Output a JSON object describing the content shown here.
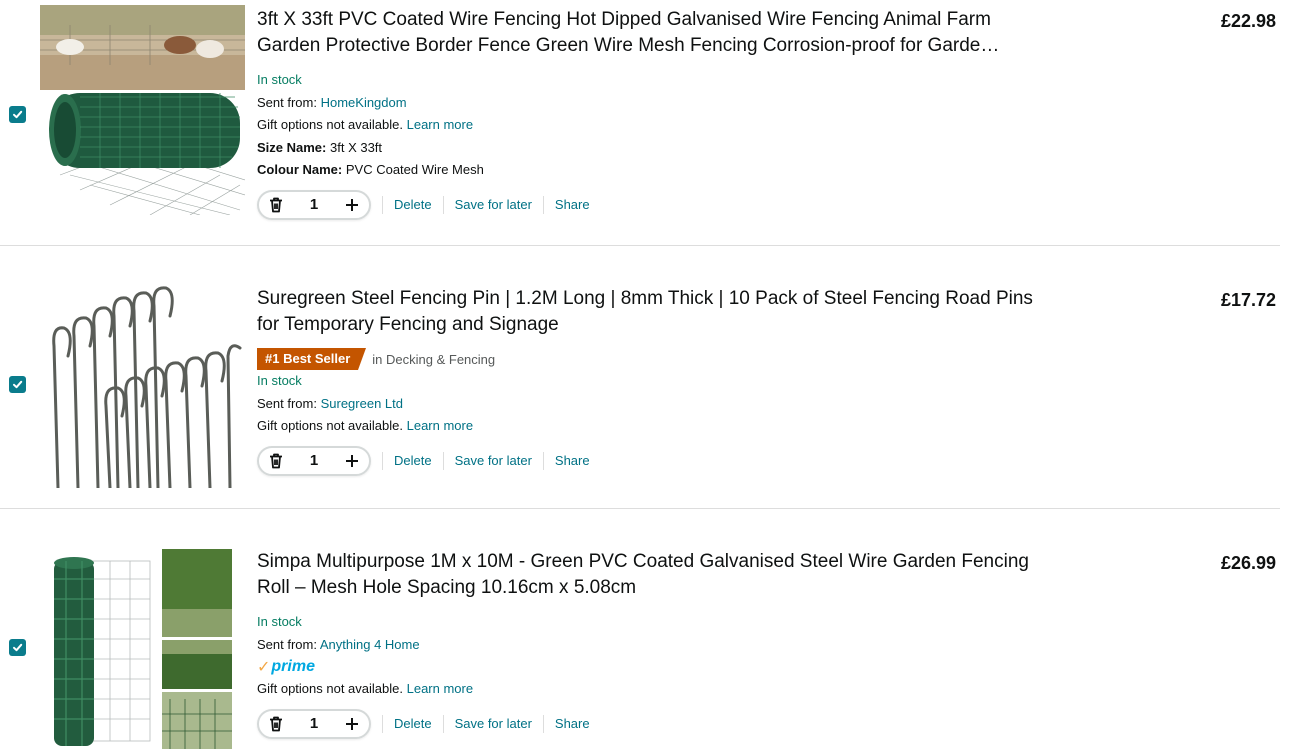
{
  "cart": {
    "items": [
      {
        "title": "3ft X 33ft PVC Coated Wire Fencing Hot Dipped Galvanised Wire Fencing Animal Farm Garden Protective Border Fence Green Wire Mesh Fencing Corrosion-proof for Garde…",
        "price": "£22.98",
        "stock": "In stock",
        "sent_from_label": "Sent from:",
        "sent_from": "HomeKingdom",
        "gift_text": "Gift options not available.",
        "learn_more": "Learn more",
        "size_label": "Size Name:",
        "size_value": "3ft X 33ft",
        "colour_label": "Colour Name:",
        "colour_value": "PVC Coated Wire Mesh",
        "quantity": "1",
        "delete_label": "Delete",
        "save_label": "Save for later",
        "share_label": "Share",
        "checked": true
      },
      {
        "title": "Suregreen Steel Fencing Pin | 1.2M Long | 8mm Thick | 10 Pack of Steel Fencing Road Pins for Temporary Fencing and Signage",
        "price": "£17.72",
        "badge": "#1 Best Seller",
        "badge_category": "in Decking & Fencing",
        "stock": "In stock",
        "sent_from_label": "Sent from:",
        "sent_from": "Suregreen Ltd",
        "gift_text": "Gift options not available.",
        "learn_more": "Learn more",
        "quantity": "1",
        "delete_label": "Delete",
        "save_label": "Save for later",
        "share_label": "Share",
        "checked": true
      },
      {
        "title": "Simpa Multipurpose 1M x 10M - Green PVC Coated Galvanised Steel Wire Garden Fencing Roll – Mesh Hole Spacing 10.16cm x 5.08cm",
        "price": "£26.99",
        "stock": "In stock",
        "sent_from_label": "Sent from:",
        "sent_from": "Anything 4 Home",
        "prime_label": "prime",
        "gift_text": "Gift options not available.",
        "learn_more": "Learn more",
        "quantity": "1",
        "delete_label": "Delete",
        "save_label": "Save for later",
        "share_label": "Share",
        "checked": true
      }
    ]
  },
  "colors": {
    "stock_green": "#067d62",
    "link_teal": "#007185",
    "checkbox_teal": "#0a7c8c",
    "badge_orange": "#c45500",
    "prime_blue": "#00a8e1",
    "prime_check": "#f3a847"
  },
  "icons": {
    "checkbox": "checkmark-icon",
    "delete": "trash-icon",
    "increase": "plus-icon"
  }
}
